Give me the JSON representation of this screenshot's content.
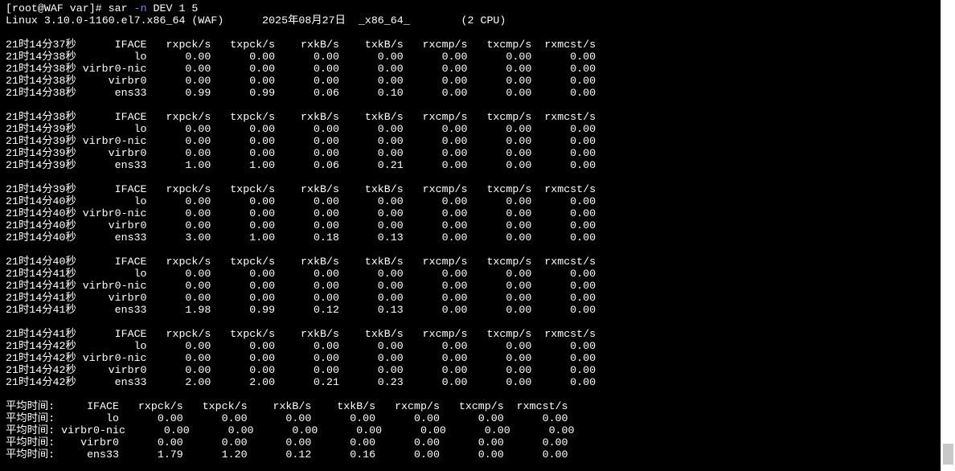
{
  "terminal": {
    "prompt": "[root@WAF var]# ",
    "cmd_name": "sar ",
    "cmd_flag": "-n",
    "cmd_args": " DEV 1 5",
    "sysinfo": "Linux 3.10.0-1160.el7.x86_64 (WAF)      2025年08月27日  _x86_64_        (2 CPU)",
    "lines": [
      "",
      "21时14分37秒      IFACE   rxpck/s   txpck/s    rxkB/s    txkB/s   rxcmp/s   txcmp/s  rxmcst/s",
      "21时14分38秒         lo      0.00      0.00      0.00      0.00      0.00      0.00      0.00",
      "21时14分38秒 virbr0-nic      0.00      0.00      0.00      0.00      0.00      0.00      0.00",
      "21时14分38秒     virbr0      0.00      0.00      0.00      0.00      0.00      0.00      0.00",
      "21时14分38秒      ens33      0.99      0.99      0.06      0.10      0.00      0.00      0.00",
      "",
      "21时14分38秒      IFACE   rxpck/s   txpck/s    rxkB/s    txkB/s   rxcmp/s   txcmp/s  rxmcst/s",
      "21时14分39秒         lo      0.00      0.00      0.00      0.00      0.00      0.00      0.00",
      "21时14分39秒 virbr0-nic      0.00      0.00      0.00      0.00      0.00      0.00      0.00",
      "21时14分39秒     virbr0      0.00      0.00      0.00      0.00      0.00      0.00      0.00",
      "21时14分39秒      ens33      1.00      1.00      0.06      0.21      0.00      0.00      0.00",
      "",
      "21时14分39秒      IFACE   rxpck/s   txpck/s    rxkB/s    txkB/s   rxcmp/s   txcmp/s  rxmcst/s",
      "21时14分40秒         lo      0.00      0.00      0.00      0.00      0.00      0.00      0.00",
      "21时14分40秒 virbr0-nic      0.00      0.00      0.00      0.00      0.00      0.00      0.00",
      "21时14分40秒     virbr0      0.00      0.00      0.00      0.00      0.00      0.00      0.00",
      "21时14分40秒      ens33      3.00      1.00      0.18      0.13      0.00      0.00      0.00",
      "",
      "21时14分40秒      IFACE   rxpck/s   txpck/s    rxkB/s    txkB/s   rxcmp/s   txcmp/s  rxmcst/s",
      "21时14分41秒         lo      0.00      0.00      0.00      0.00      0.00      0.00      0.00",
      "21时14分41秒 virbr0-nic      0.00      0.00      0.00      0.00      0.00      0.00      0.00",
      "21时14分41秒     virbr0      0.00      0.00      0.00      0.00      0.00      0.00      0.00",
      "21时14分41秒      ens33      1.98      0.99      0.12      0.13      0.00      0.00      0.00",
      "",
      "21时14分41秒      IFACE   rxpck/s   txpck/s    rxkB/s    txkB/s   rxcmp/s   txcmp/s  rxmcst/s",
      "21时14分42秒         lo      0.00      0.00      0.00      0.00      0.00      0.00      0.00",
      "21时14分42秒 virbr0-nic      0.00      0.00      0.00      0.00      0.00      0.00      0.00",
      "21时14分42秒     virbr0      0.00      0.00      0.00      0.00      0.00      0.00      0.00",
      "21时14分42秒      ens33      2.00      2.00      0.21      0.23      0.00      0.00      0.00",
      "",
      "平均时间:     IFACE   rxpck/s   txpck/s    rxkB/s    txkB/s   rxcmp/s   txcmp/s  rxmcst/s",
      "平均时间:        lo      0.00      0.00      0.00      0.00      0.00      0.00      0.00",
      "平均时间: virbr0-nic      0.00      0.00      0.00      0.00      0.00      0.00      0.00",
      "平均时间:    virbr0      0.00      0.00      0.00      0.00      0.00      0.00      0.00",
      "平均时间:     ens33      1.79      1.20      0.12      0.16      0.00      0.00      0.00"
    ]
  },
  "colors": {
    "background": "#000000",
    "foreground": "#ffffff",
    "option_flag": "#5b8cff"
  }
}
